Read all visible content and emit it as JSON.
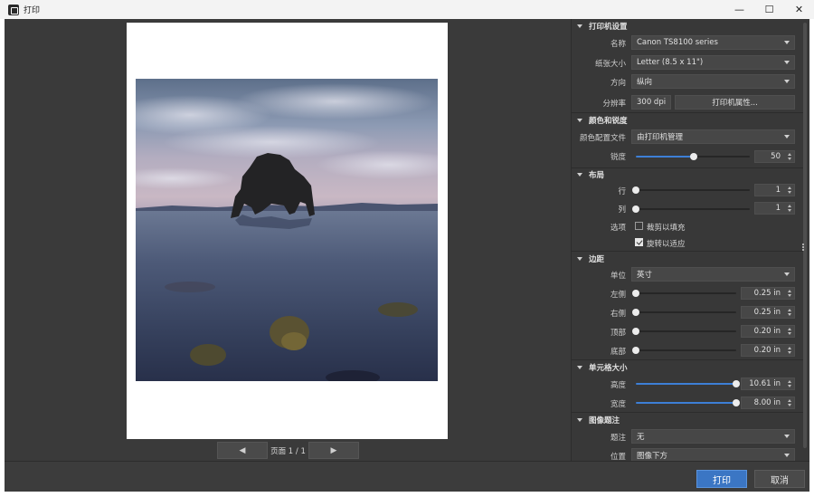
{
  "window": {
    "title": "打印",
    "controls": {
      "minimize": "—",
      "maximize": "☐",
      "close": "✕"
    }
  },
  "pager": {
    "prev": "◀",
    "next": "▶",
    "label": "页面 1 / 1"
  },
  "printer": {
    "header": "打印机设置",
    "name_label": "名称",
    "name_value": "Canon TS8100 series",
    "paper_label": "纸张大小",
    "paper_value": "Letter (8.5 x 11\")",
    "orientation_label": "方向",
    "orientation_value": "纵向",
    "resolution_label": "分辨率",
    "resolution_value": "300 dpi",
    "properties_button": "打印机属性..."
  },
  "color": {
    "header": "颜色和锐度",
    "profile_label": "颜色配置文件",
    "profile_value": "由打印机管理",
    "sharpness_label": "锐度",
    "sharpness_value": "50",
    "sharpness_fraction": 0.5
  },
  "layout": {
    "header": "布局",
    "rows_label": "行",
    "rows_value": "1",
    "cols_label": "列",
    "cols_value": "1",
    "options_label": "选项",
    "crop_label": "裁剪以填充",
    "crop_checked": false,
    "rotate_label": "旋转以适应",
    "rotate_checked": true
  },
  "margins": {
    "header": "边距",
    "unit_label": "单位",
    "unit_value": "英寸",
    "left_label": "左侧",
    "left_value": "0.25 in",
    "right_label": "右侧",
    "right_value": "0.25 in",
    "top_label": "顶部",
    "top_value": "0.20 in",
    "bottom_label": "底部",
    "bottom_value": "0.20 in"
  },
  "cell": {
    "header": "单元格大小",
    "height_label": "高度",
    "height_value": "10.61 in",
    "height_fraction": 1.0,
    "width_label": "宽度",
    "width_value": "8.00 in",
    "width_fraction": 1.0
  },
  "caption": {
    "header": "图像题注",
    "caption_label": "题注",
    "caption_value": "无",
    "position_label": "位置",
    "position_value": "图像下方"
  },
  "footer": {
    "print": "打印",
    "cancel": "取消"
  },
  "colors": {
    "accent": "#3b76c4",
    "panel": "#383838",
    "background": "#3c3c3c"
  }
}
